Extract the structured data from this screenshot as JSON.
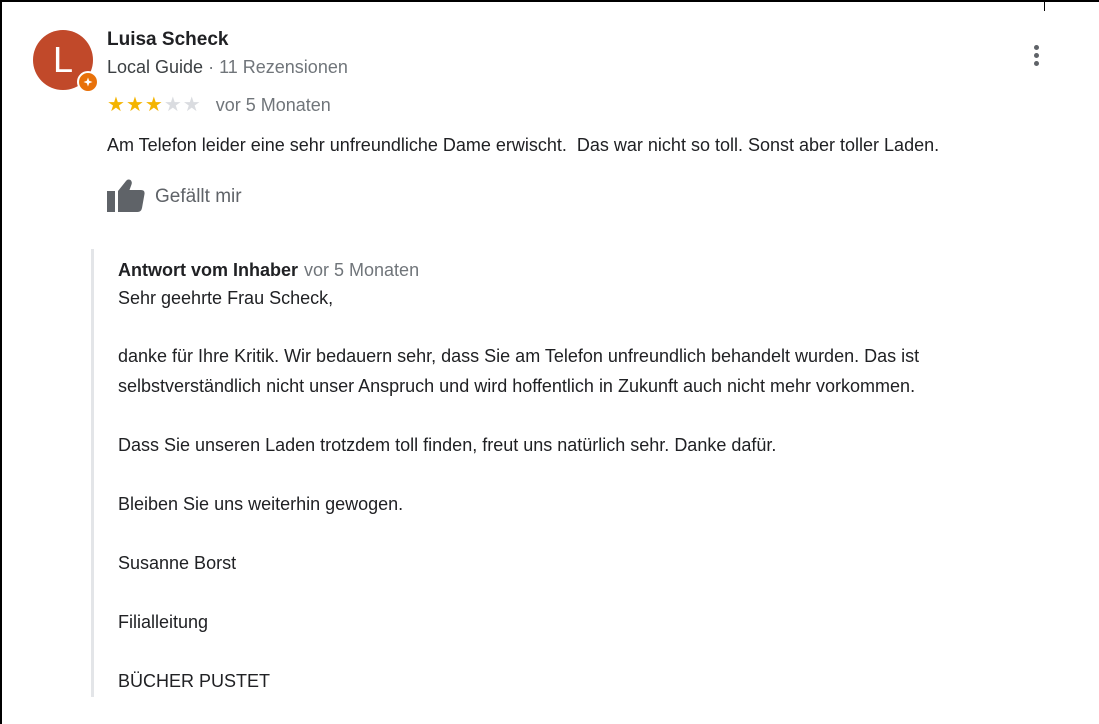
{
  "review": {
    "reviewer_name": "Luisa Scheck",
    "reviewer_initial": "L",
    "reviewer_badge": "Local Guide",
    "reviewer_review_count": "· 11 Rezensionen",
    "avatar_color": "#c1492a",
    "badge_color": "#e8710a",
    "rating": 3,
    "max_rating": 5,
    "star_color": "#f4b400",
    "time": "vor 5 Monaten",
    "text": "Am Telefon leider eine sehr unfreundliche Dame erwischt.  Das war nicht so toll. Sonst aber toller Laden.",
    "like_label": "Gefällt mir",
    "like_icon": "thumbs-up-icon",
    "more_icon": "more-vertical-icon"
  },
  "owner_reply": {
    "label": "Antwort vom Inhaber",
    "time": "vor 5 Monaten",
    "lines": [
      "Sehr geehrte Frau Scheck,",
      "danke für Ihre Kritik. Wir bedauern sehr, dass Sie am Telefon unfreundlich behandelt wurden. Das ist",
      "selbstverständlich nicht unser Anspruch und wird hoffentlich in Zukunft auch nicht mehr vorkommen.",
      "Dass Sie unseren Laden trotzdem toll finden, freut uns natürlich sehr. Danke dafür.",
      "Bleiben Sie uns weiterhin gewogen.",
      "Susanne Borst",
      "Filialleitung",
      "BÜCHER PUSTET"
    ]
  }
}
